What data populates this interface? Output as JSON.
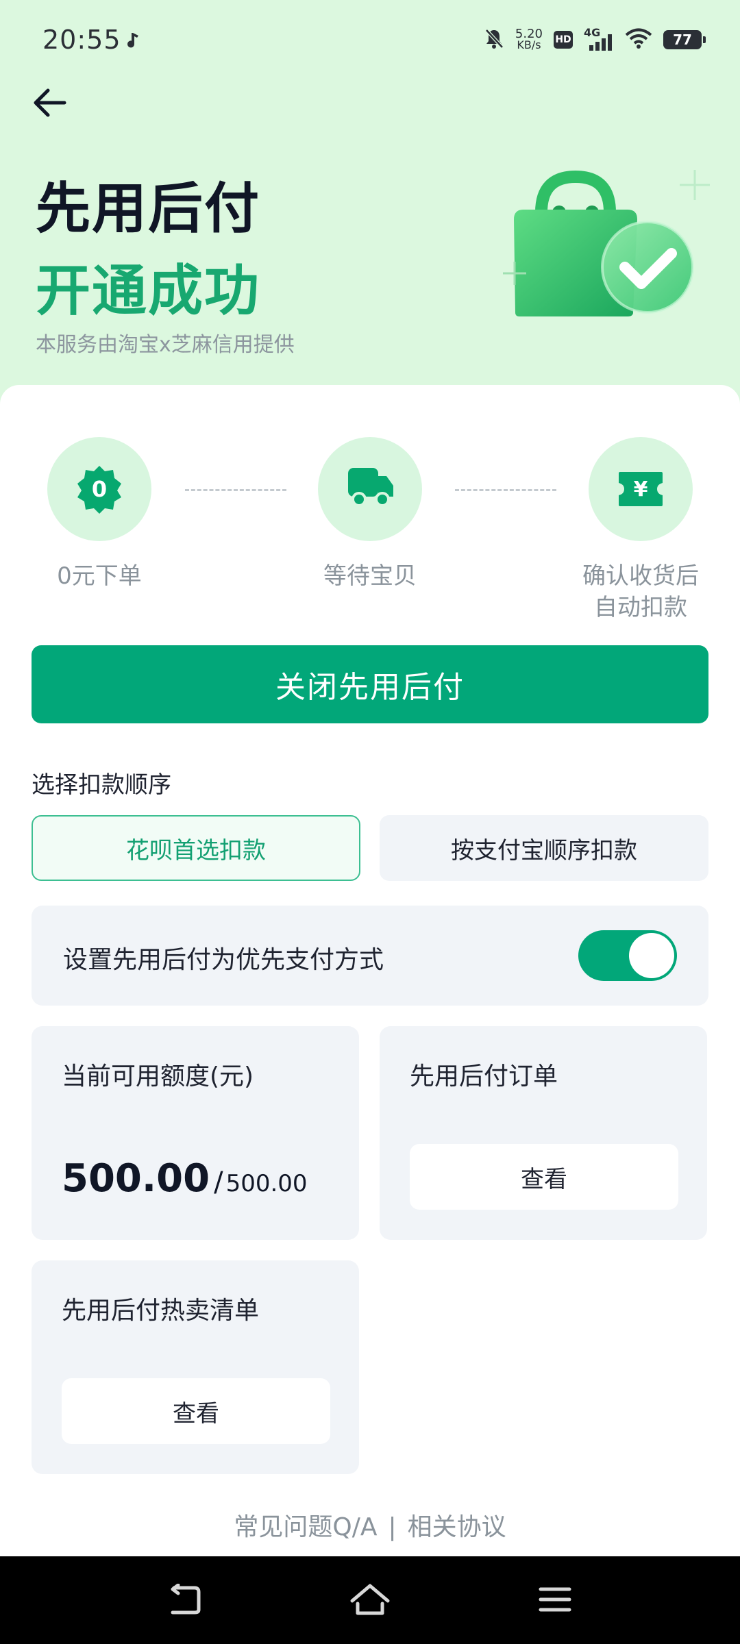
{
  "status_bar": {
    "time": "20:55",
    "speed_value": "5.20",
    "speed_unit": "KB/s",
    "hd_label": "HD",
    "network_label": "4G",
    "battery_level": "77"
  },
  "hero": {
    "title": "先用后付",
    "subtitle": "开通成功",
    "provider_text": "本服务由淘宝x芝麻信用提供"
  },
  "steps": [
    {
      "label": "0元下单",
      "icon": "zero-badge-icon",
      "badge_text": "0"
    },
    {
      "label": "等待宝贝",
      "icon": "delivery-truck-icon"
    },
    {
      "label_line1": "确认收货后",
      "label_line2": "自动扣款",
      "icon": "yuan-ticket-icon",
      "badge_text": "¥"
    }
  ],
  "close_button_label": "关闭先用后付",
  "deduction_order": {
    "title": "选择扣款顺序",
    "options": [
      {
        "label": "花呗首选扣款",
        "selected": true
      },
      {
        "label": "按支付宝顺序扣款",
        "selected": false
      }
    ]
  },
  "preferred_payment": {
    "label": "设置先用后付为优先支付方式",
    "enabled": true
  },
  "credit_tile": {
    "title": "当前可用额度(元)",
    "available": "500.00",
    "separator": "/",
    "total": "500.00"
  },
  "orders_tile": {
    "title": "先用后付订单",
    "button_label": "查看"
  },
  "hot_list_tile": {
    "title": "先用后付热卖清单",
    "button_label": "查看"
  },
  "footer": {
    "faq_link": "常见问题Q/A",
    "divider": "|",
    "agreement_link": "相关协议"
  },
  "colors": {
    "hero_background": "#dcf8df",
    "accent_green": "#02a779",
    "title_green": "#18a870",
    "card_gray": "#f1f4f8"
  }
}
